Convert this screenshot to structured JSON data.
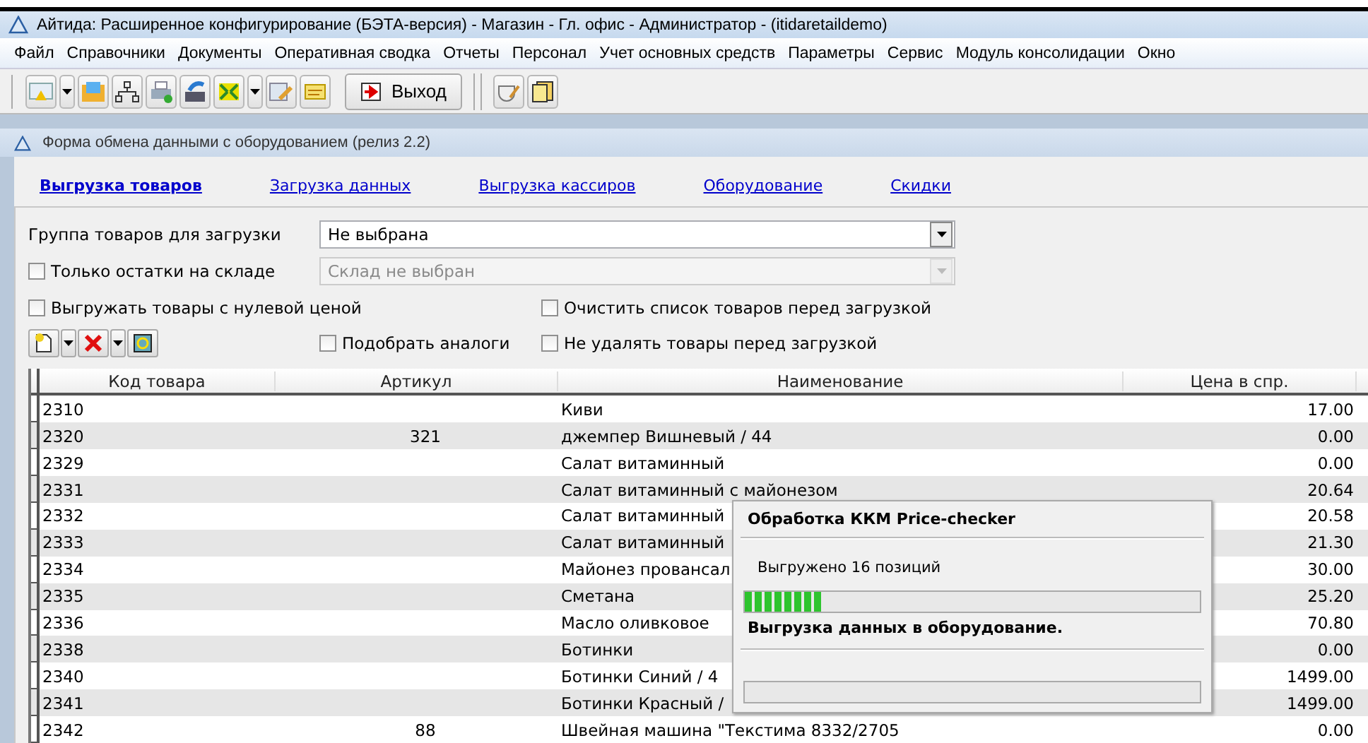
{
  "window": {
    "title": "Айтида: Расширенное конфигурирование (БЭТА-версия) - Магазин - Гл. офис - Администратор - (itidaretaildemo)"
  },
  "menu": [
    "Файл",
    "Справочники",
    "Документы",
    "Оперативная сводка",
    "Отчеты",
    "Персонал",
    "Учет основных средств",
    "Параметры",
    "Сервис",
    "Модуль консолидации",
    "Окно"
  ],
  "toolbar": {
    "exit_button": "Выход"
  },
  "form": {
    "title": "Форма обмена данными с оборудованием (релиз 2.2)",
    "tabs": [
      {
        "label": "Выгрузка товаров",
        "selected": true
      },
      {
        "label": "Загрузка данных",
        "selected": false
      },
      {
        "label": "Выгрузка кассиров",
        "selected": false
      },
      {
        "label": "Оборудование",
        "selected": false
      },
      {
        "label": "Скидки",
        "selected": false
      }
    ],
    "group_field": {
      "label": "Группа товаров для загрузки",
      "value": "Не выбрана",
      "disabled": false
    },
    "stock_field": {
      "label": "Только остатки на складе",
      "checked": false,
      "value": "Склад не выбран",
      "disabled": true
    },
    "options": [
      {
        "label": "Выгружать товары с нулевой ценой",
        "checked": false
      },
      {
        "label": "Очистить список товаров перед загрузкой",
        "checked": false
      },
      {
        "label": "Подобрать аналоги",
        "checked": false
      },
      {
        "label": "Не удалять товары перед загрузкой",
        "checked": false
      }
    ],
    "table": {
      "columns": [
        "Код товара",
        "Артикул",
        "Наименование",
        "Цена в спр."
      ],
      "rows": [
        [
          "2310",
          "",
          "Киви",
          "17.00"
        ],
        [
          "2320",
          "321",
          "джемпер Вишневый / 44",
          "0.00"
        ],
        [
          "2329",
          "",
          "Салат витаминный",
          "0.00"
        ],
        [
          "2331",
          "",
          "Салат витаминный с майонезом",
          "20.64"
        ],
        [
          "2332",
          "",
          "Салат витаминный",
          "20.58"
        ],
        [
          "2333",
          "",
          "Салат витаминный",
          "21.30"
        ],
        [
          "2334",
          "",
          "Майонез провансал",
          "30.00"
        ],
        [
          "2335",
          "",
          "Сметана",
          "25.20"
        ],
        [
          "2336",
          "",
          "Масло оливковое",
          "70.80"
        ],
        [
          "2338",
          "",
          "Ботинки",
          "0.00"
        ],
        [
          "2340",
          "",
          "Ботинки Синий / 4",
          "1499.00"
        ],
        [
          "2341",
          "",
          "Ботинки Красный /",
          "1499.00"
        ],
        [
          "2342",
          "88",
          "Швейная машина \"Текстима 8332/2705",
          "0.00"
        ]
      ]
    }
  },
  "dialog": {
    "title": "Обработка ККМ Price-checker",
    "message": "Выгружено 16 позиций",
    "progress": {
      "level": 0.17
    },
    "status": "Выгрузка данных в оборудование.",
    "progress2": {
      "level": 0
    }
  }
}
